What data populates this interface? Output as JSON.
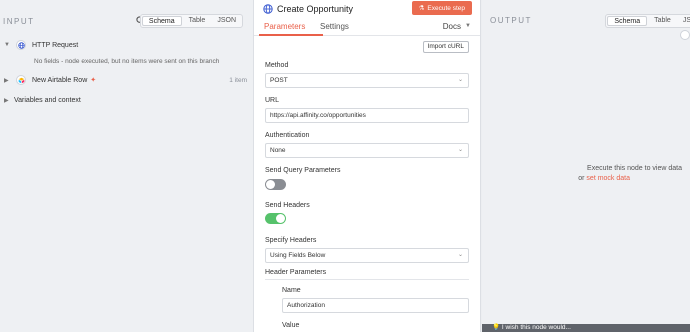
{
  "input": {
    "title": "INPUT",
    "view_tabs": [
      "Schema",
      "Table",
      "JSON"
    ],
    "active_tab": "Schema",
    "rows": [
      {
        "label": "HTTP Request",
        "icon": "globe-icon",
        "expanded": true
      },
      {
        "label": "New Airtable Row",
        "icon": "airtable-icon",
        "pinned": true,
        "count": "1 item"
      },
      {
        "label": "Variables and context"
      }
    ],
    "note": "No fields - node executed, but no items were sent on this branch"
  },
  "modal": {
    "title": "Create Opportunity",
    "execute_label": "Execute step",
    "tabs": [
      "Parameters",
      "Settings"
    ],
    "active_tab": "Parameters",
    "docs_label": "Docs",
    "import_label": "Import cURL",
    "method": {
      "label": "Method",
      "value": "POST"
    },
    "url": {
      "label": "URL",
      "value": "https://api.affinity.co/opportunities"
    },
    "auth": {
      "label": "Authentication",
      "value": "None"
    },
    "send_query": {
      "label": "Send Query Parameters",
      "on": false
    },
    "send_headers": {
      "label": "Send Headers",
      "on": true
    },
    "specify_headers": {
      "label": "Specify Headers",
      "value": "Using Fields Below"
    },
    "header_params": {
      "label": "Header Parameters"
    },
    "name": {
      "label": "Name",
      "value": "Authorization"
    },
    "value": {
      "label": "Value"
    }
  },
  "output": {
    "title": "OUTPUT",
    "view_tabs": [
      "Schema",
      "Table",
      "JS"
    ],
    "active_tab": "Schema",
    "empty_line1": "Execute this node to view data",
    "empty_or": "or",
    "mock_link": "set mock data",
    "wish": "I wish this node would..."
  },
  "colors": {
    "accent": "#ea6b4f",
    "toggle_on": "#56c26b",
    "toggle_off": "#8a8d93"
  }
}
